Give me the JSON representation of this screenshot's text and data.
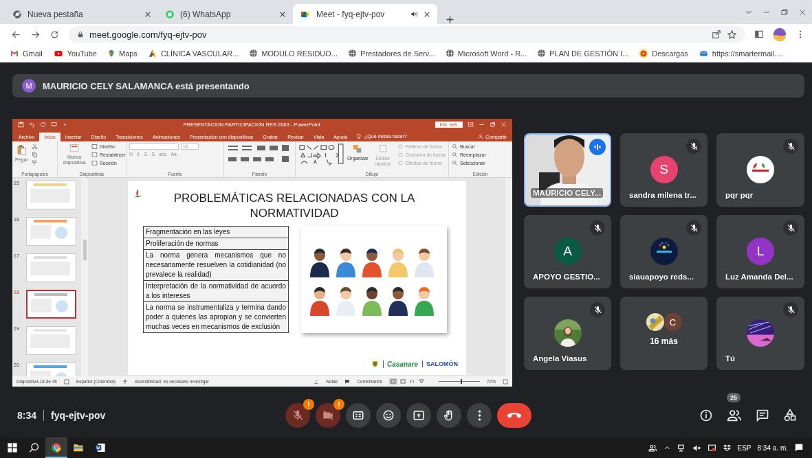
{
  "browser": {
    "tabs": [
      {
        "title": "Nueva pestaña",
        "selected": false,
        "audio": false
      },
      {
        "title": "(6) WhatsApp",
        "selected": false,
        "audio": false
      },
      {
        "title": "Meet - fyq-ejtv-pov",
        "selected": true,
        "audio": true
      }
    ],
    "url": "meet.google.com/fyq-ejtv-pov",
    "bookmarks": [
      {
        "label": "Gmail"
      },
      {
        "label": "YouTube"
      },
      {
        "label": "Maps"
      },
      {
        "label": "CLÍNICA VASCULAR..."
      },
      {
        "label": "MODULO RESIDUO..."
      },
      {
        "label": "Prestadores de Serv..."
      },
      {
        "label": "Microsoft Word - R..."
      },
      {
        "label": "PLAN DE GESTIÓN I..."
      },
      {
        "label": "Descargas"
      },
      {
        "label": "https://smartermail...."
      }
    ]
  },
  "presenter_banner": {
    "initial": "M",
    "color": "#8c5ccf",
    "text": "MAURICIO CELY SALAMANCA está presentando"
  },
  "powerpoint": {
    "title": "PRESENTACION PARTICIPACION RES 2063 - PowerPoint",
    "sign_in": "Inic. ses.",
    "tabs": [
      {
        "label": "Archivo",
        "selected": false
      },
      {
        "label": "Inicio",
        "selected": true
      },
      {
        "label": "Insertar",
        "selected": false
      },
      {
        "label": "Diseño",
        "selected": false
      },
      {
        "label": "Transiciones",
        "selected": false
      },
      {
        "label": "Animaciones",
        "selected": false
      },
      {
        "label": "Presentación con diapositivas",
        "selected": false
      },
      {
        "label": "Grabar",
        "selected": false
      },
      {
        "label": "Revisar",
        "selected": false
      },
      {
        "label": "Vista",
        "selected": false
      },
      {
        "label": "Ayuda",
        "selected": false
      }
    ],
    "tell_me": "¿Qué desea hacer?",
    "share": "Compartir",
    "groups": [
      {
        "kind": "clipboard",
        "label": "Portapapeles",
        "disabled": false,
        "items": [
          "Pegar"
        ]
      },
      {
        "kind": "slides",
        "label": "Diapositivas",
        "disabled": false,
        "items": [
          "Nueva diapositiva",
          "Diseño",
          "Restablecer",
          "Sección"
        ]
      },
      {
        "kind": "font",
        "label": "Fuente",
        "disabled": true,
        "size": "18",
        "items": [
          "N",
          "K",
          "S",
          "S",
          "abc",
          "Aa"
        ]
      },
      {
        "kind": "paragraph",
        "label": "Párrafo",
        "disabled": false
      },
      {
        "kind": "drawing",
        "label": "Dibujo",
        "disabled": false,
        "items": [
          {
            "label": "Organizar",
            "disabled": false
          },
          {
            "label": "Estilos rápidos",
            "disabled": true
          }
        ],
        "shape_options": [
          {
            "label": "Relleno de forma",
            "disabled": true
          },
          {
            "label": "Contorno de forma",
            "disabled": true
          },
          {
            "label": "Efectos de forma",
            "disabled": true
          }
        ]
      },
      {
        "kind": "editing",
        "label": "Edición",
        "disabled": false,
        "items": [
          "Buscar",
          "Reemplazar",
          "Seleccionar"
        ]
      }
    ],
    "thumbnails": [
      {
        "number": "15",
        "selected": false
      },
      {
        "number": "16",
        "selected": false
      },
      {
        "number": "17",
        "selected": false
      },
      {
        "number": "18",
        "selected": true
      },
      {
        "number": "19",
        "selected": false
      },
      {
        "number": "20",
        "selected": false
      }
    ],
    "slide": {
      "title": "PROBLEMÁTICAS RELACIONADAS CON LA NORMATIVIDAD",
      "rows": [
        "Fragmentación en las leyes",
        "Proliferación de normas",
        "La norma genera mecanismos que no necesariamente resuelven la cotidianidad (no prevalece la realidad)",
        "Interpretación de la normatividad de acuerdo a los intereses",
        "La norma se instrumentaliza y termina dando poder a quienes las apropian y se convierten muchas veces en mecanismos de exclusión"
      ],
      "logos": [
        "Casanare",
        "SALOMÓN"
      ]
    },
    "status": {
      "slide": "Diapositiva 18 de 46",
      "language": "Español (Colombia)",
      "accessibility": "Accesibilidad: es necesario investigar",
      "notes": "Notas",
      "comments": "Comentarios",
      "zoom": {
        "level": 0.55,
        "reading": "72%"
      }
    }
  },
  "tiles": [
    {
      "name": "MAURICIO CELY...",
      "kind": "video",
      "muted": false,
      "speaking": true
    },
    {
      "name": "sandra milena tr...",
      "kind": "letter",
      "initial": "S",
      "color": "#e8436f",
      "muted": true,
      "speaking": false
    },
    {
      "name": "pqr pqr",
      "muted": true,
      "speaking": false
    },
    {
      "name": "APOYO GESTIO...",
      "kind": "letter",
      "initial": "A",
      "color": "#0b5a44",
      "muted": true,
      "speaking": false
    },
    {
      "name": "siauapoyo reds...",
      "muted": true,
      "speaking": false
    },
    {
      "name": "Luz Amanda Del...",
      "kind": "letter",
      "initial": "L",
      "color": "#9334c6",
      "muted": true,
      "speaking": false
    },
    {
      "name": "Angela Viasus",
      "muted": true,
      "speaking": false
    },
    {
      "name": "16 más",
      "kind": "group",
      "initial": "C",
      "color": "#6d4136",
      "muted": false,
      "speaking": false
    },
    {
      "name": "Tú",
      "muted": true,
      "speaking": false
    }
  ],
  "call_bar": {
    "time": "8:34",
    "meeting_code": "fyq-ejtv-pov",
    "toggles": [
      {
        "kind": "mic",
        "on": false,
        "alert": "!"
      },
      {
        "kind": "camera",
        "on": false,
        "alert": "!"
      }
    ],
    "actions": [
      {
        "kind": "captions"
      },
      {
        "kind": "emoji"
      },
      {
        "kind": "present"
      },
      {
        "kind": "hand"
      },
      {
        "kind": "more"
      },
      {
        "kind": "hangup"
      }
    ],
    "participant_count": "25"
  },
  "taskbar": {
    "apps": [
      {
        "kind": "start",
        "active": false
      },
      {
        "kind": "search",
        "active": false
      },
      {
        "kind": "chrome",
        "active": true
      },
      {
        "kind": "files",
        "active": false
      },
      {
        "kind": "word",
        "active": false
      }
    ],
    "language": "ESP",
    "time": "8:34 a. m."
  }
}
